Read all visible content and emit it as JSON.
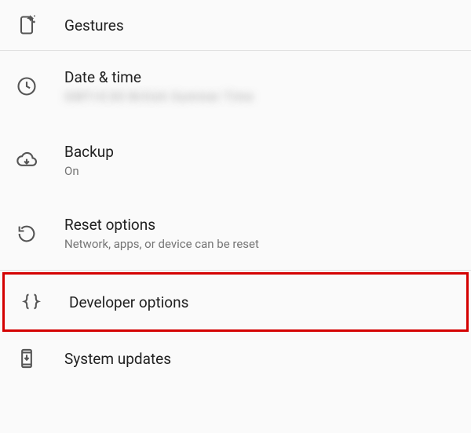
{
  "items": {
    "gestures": {
      "title": "Gestures"
    },
    "datetime": {
      "title": "Date & time",
      "subtitle": "GMT+0:00 British Summer Time"
    },
    "backup": {
      "title": "Backup",
      "subtitle": "On"
    },
    "reset": {
      "title": "Reset options",
      "subtitle": "Network, apps, or device can be reset"
    },
    "developer": {
      "title": "Developer options"
    },
    "updates": {
      "title": "System updates"
    }
  }
}
